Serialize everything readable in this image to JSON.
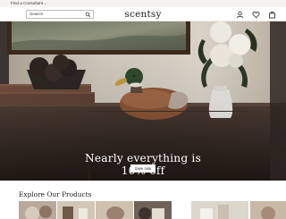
{
  "topbar": {
    "consultant_label": "Find a Consultant",
    "chevron_icon": "chevron-down-icon"
  },
  "header": {
    "search": {
      "placeholder": "Search",
      "icon": "search-icon"
    },
    "logo": "scentsy",
    "icons": [
      "user-icon",
      "heart-icon",
      "bag-icon"
    ]
  },
  "hero": {
    "headline_line1": "Nearly everything is",
    "headline_line2": "10% off",
    "cta_label": "Save now"
  },
  "explore": {
    "title": "Explore Our Products",
    "tiles": [
      "product-tile-1",
      "product-tile-2",
      "product-tile-3",
      "product-tile-4",
      "product-tile-5",
      "product-tile-6"
    ]
  },
  "colors": {
    "hero_dark": "#2a2320",
    "wall": "#cfc8bd",
    "cta_bg": "#ffffff"
  }
}
